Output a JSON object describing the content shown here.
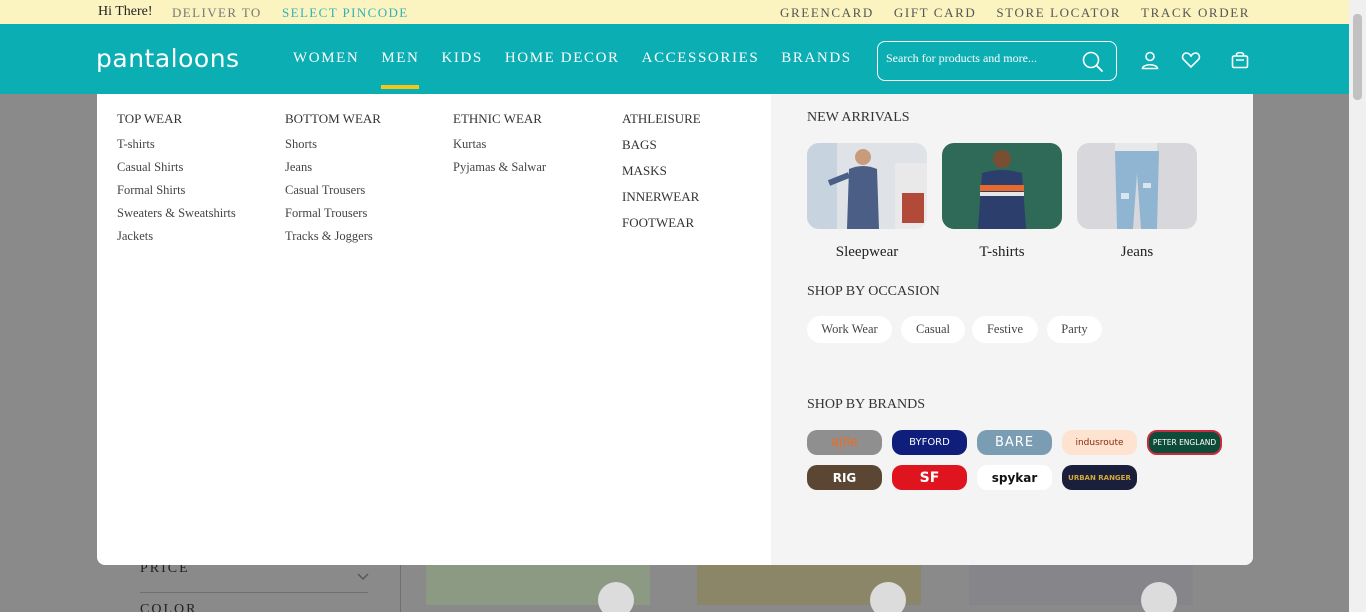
{
  "topbar": {
    "greeting": "Hi There!",
    "deliver_to": "DELIVER TO",
    "select_pincode": "SELECT PINCODE",
    "links": [
      "GREENCARD",
      "GIFT CARD",
      "STORE LOCATOR",
      "TRACK ORDER"
    ]
  },
  "header": {
    "logo": "pantaloons",
    "nav": [
      "WOMEN",
      "MEN",
      "KIDS",
      "HOME DECOR",
      "ACCESSORIES",
      "BRANDS"
    ],
    "active_nav": "MEN",
    "search_placeholder": "Search for products and more...",
    "accent": "#0aaeb3",
    "highlight": "#f5c518"
  },
  "menu": {
    "top_wear": {
      "title": "TOP WEAR",
      "items": [
        "T-shirts",
        "Casual Shirts",
        "Formal Shirts",
        "Sweaters & Sweatshirts",
        "Jackets"
      ]
    },
    "bottom_wear": {
      "title": "BOTTOM WEAR",
      "items": [
        "Shorts",
        "Jeans",
        "Casual Trousers",
        "Formal Trousers",
        "Tracks & Joggers"
      ]
    },
    "ethnic_wear": {
      "title": "ETHNIC WEAR",
      "items": [
        "Kurtas",
        "Pyjamas & Salwar"
      ]
    },
    "other": [
      "ATHLEISURE",
      "BAGS",
      "MASKS",
      "INNERWEAR",
      "FOOTWEAR"
    ]
  },
  "right": {
    "new_arrivals_title": "NEW ARRIVALS",
    "new_arrivals": [
      "Sleepwear",
      "T-shirts",
      "Jeans"
    ],
    "occasion_title": "SHOP BY OCCASION",
    "occasions": [
      "Work Wear",
      "Casual",
      "Festive",
      "Party"
    ],
    "brands_title": "SHOP BY BRANDS",
    "brands": [
      "ajile",
      "BYFORD",
      "BARE",
      "indusroute",
      "PETER ENGLAND",
      "RIG",
      "SF",
      "spykar",
      "URBAN RANGER"
    ]
  },
  "background": {
    "filters": [
      "PRICE",
      "COLOR"
    ]
  }
}
